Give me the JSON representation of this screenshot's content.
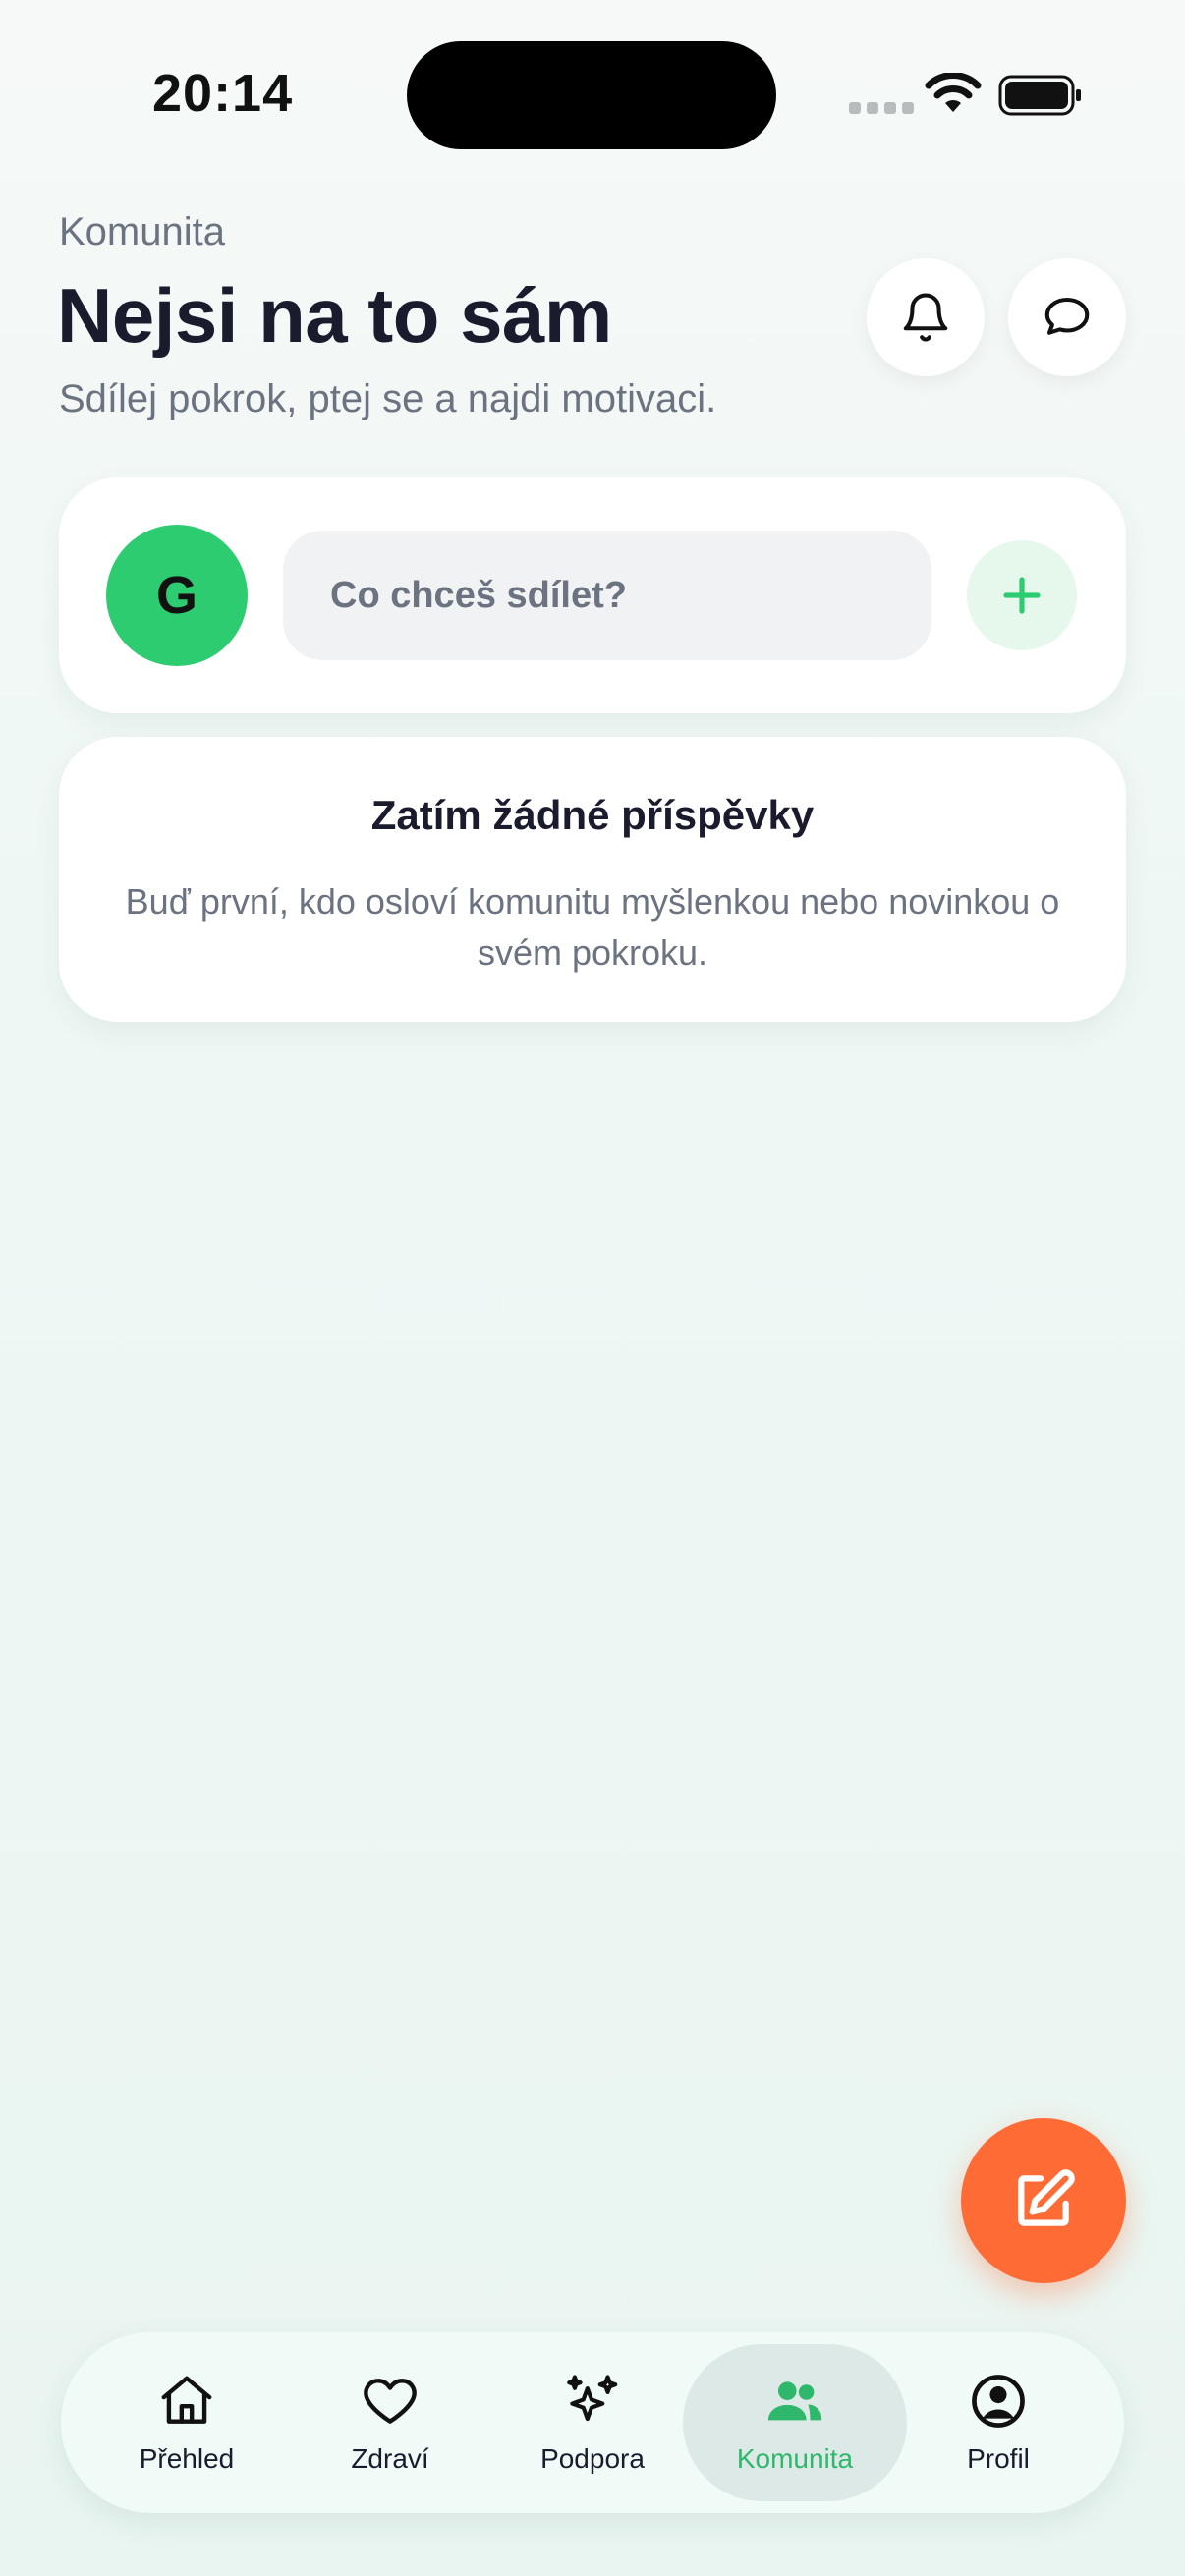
{
  "status_bar": {
    "time": "20:14"
  },
  "header": {
    "section_label": "Komunita",
    "title": "Nejsi na to sám",
    "subtitle": "Sdílej pokrok, ptej se a najdi motivaci.",
    "notification_icon": "bell-icon",
    "messages_icon": "chat-bubble-icon"
  },
  "composer": {
    "avatar_initial": "G",
    "placeholder": "Co chceš sdílet?",
    "add_icon": "plus-icon"
  },
  "empty_state": {
    "title": "Zatím žádné příspěvky",
    "text": "Buď první, kdo osloví komunitu myšlenkou nebo novinkou o svém pokroku."
  },
  "fab": {
    "icon": "compose-icon"
  },
  "bottom_nav": {
    "active": "Komunita",
    "items": [
      {
        "label": "Přehled",
        "icon": "home-icon"
      },
      {
        "label": "Zdraví",
        "icon": "heart-icon"
      },
      {
        "label": "Podpora",
        "icon": "sparkles-icon"
      },
      {
        "label": "Komunita",
        "icon": "people-icon"
      },
      {
        "label": "Profil",
        "icon": "user-circle-icon"
      }
    ]
  },
  "colors": {
    "accent_green": "#2ecc71",
    "active_nav_green": "#2fb86b",
    "fab_orange": "#ff6b35",
    "title_dark": "#1b1b2e",
    "muted_text": "#6b7280"
  }
}
